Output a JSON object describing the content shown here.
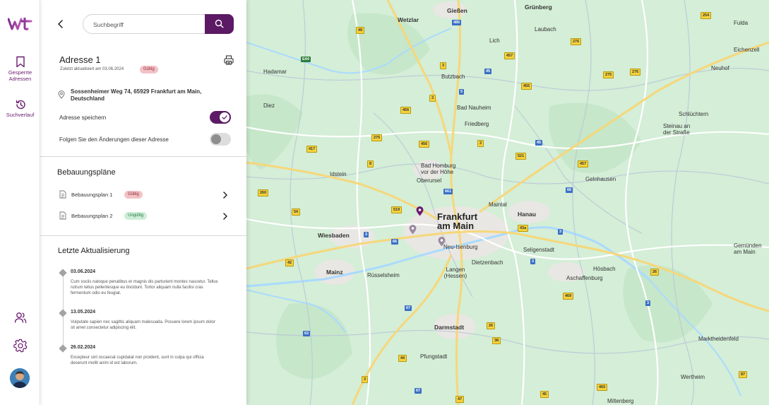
{
  "rail": {
    "saved_label": "Gesperrte\nAdressen",
    "history_label": "Suchverlauf"
  },
  "search": {
    "placeholder": "Suchbegriff"
  },
  "address": {
    "title": "Adresse 1",
    "updated": "Zuletzt aktualisiert am 03.06.2024",
    "status": "Gültig",
    "text": "Sossenheimer Weg 74, 65929 Frankfurt am Main, Deutschland",
    "save_label": "Adresse speichern",
    "save_on": true,
    "follow_label": "Folgen Sie den Änderungen dieser Adresse",
    "follow_on": false
  },
  "plans": {
    "title": "Bebauungspläne",
    "items": [
      {
        "name": "Bebauungsplan 1",
        "status": "Gültig"
      },
      {
        "name": "Bebauungsplan 2",
        "status": "Ungültig"
      }
    ]
  },
  "updates": {
    "title": "Letzte Aktualisierung",
    "items": [
      {
        "date": "03.06.2024",
        "text": "Cum sociis natoque penatibus et magnis dis parturient montes nascetur. Tellus rutrum tellus pellentesque eu tincidunt. Tortor aliquam nulla facilisi cras fermentum odio eu feugiat."
      },
      {
        "date": "13.05.2024",
        "text": "Vulputate sapien nec sagittis aliquam malesuada. Posuere lorem ipsum dolor sit amet consectetur adipiscing elit."
      },
      {
        "date": "26.02.2024",
        "text": "Excepteur sint occaecat cupidatat non proident, sunt in culpa qui officia deserunt mollit anim id est laborum."
      }
    ]
  },
  "map": {
    "cities": [
      "Gießen",
      "Grünberg",
      "Wetzlar",
      "Laubach",
      "Fulda",
      "Lich",
      "Eichenzell",
      "Hadamar",
      "Butzbach",
      "Neuhof",
      "Diez",
      "Bad Nauheim",
      "Schlüchtern",
      "Friedberg",
      "Steinau an der Straße",
      "Bad Homburg vor der Höhe",
      "Idstein",
      "Gelnhausen",
      "Oberursel",
      "Maintal",
      "Hanau",
      "Wiesbaden",
      "Neu-Isenburg",
      "Seligenstadt",
      "Mainz",
      "Rüsselsheim",
      "Dietzenbach",
      "Langen (Hessen)",
      "Hösbach",
      "Aschaffenburg",
      "Gemünden am Main",
      "Darmstadt",
      "Pfungstadt",
      "Marktheidenfeld",
      "Wertheim",
      "Miltenberg",
      "Frankfurt am Main"
    ],
    "shields": [
      "49",
      "485",
      "457",
      "276",
      "275",
      "276",
      "254",
      "E44",
      "3",
      "455",
      "456",
      "45",
      "5",
      "3",
      "456",
      "275",
      "417",
      "3",
      "8",
      "457",
      "521",
      "45",
      "260",
      "661",
      "66",
      "54",
      "519",
      "3",
      "43a",
      "66",
      "42",
      "3",
      "3",
      "26",
      "469",
      "3",
      "67",
      "26",
      "63",
      "38",
      "44",
      "67",
      "45",
      "460",
      "47",
      "3",
      "87"
    ],
    "colors": {
      "land": "#d4eed7",
      "urban": "#e9e7e3",
      "road": "#ffffff",
      "motorway": "#f6d77a",
      "water": "#aadaff",
      "pin": "#6a1b6e"
    }
  }
}
